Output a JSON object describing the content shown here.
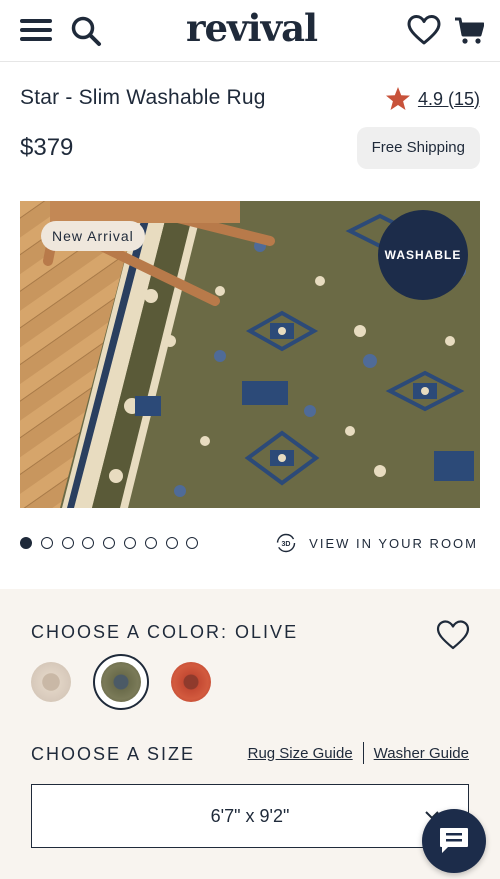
{
  "header": {
    "logo": "revival",
    "icons": [
      "menu-icon",
      "search-icon",
      "heart-icon",
      "cart-icon"
    ]
  },
  "product": {
    "title": "Star - Slim Washable Rug",
    "rating": "4.9",
    "review_count": "(15)",
    "price": "$379",
    "shipping_badge": "Free Shipping"
  },
  "gallery": {
    "new_badge": "New Arrival",
    "washable_badge": "WASHABLE",
    "slide_count": 9,
    "active_slide": 1,
    "view_room_label": "VIEW IN YOUR ROOM"
  },
  "options": {
    "color_heading": "CHOOSE A COLOR: OLIVE",
    "colors": [
      {
        "name": "beige",
        "hex": "#d9cbbd"
      },
      {
        "name": "olive",
        "hex": "#6b6c4b",
        "selected": true
      },
      {
        "name": "red",
        "hex": "#c44a33"
      }
    ],
    "size_heading": "CHOOSE A SIZE",
    "rug_size_guide": "Rug Size Guide",
    "washer_guide": "Washer Guide",
    "selected_size": "6'7\" x 9'2\""
  },
  "colors": {
    "navy": "#1c2c4a",
    "text": "#1f2a3a",
    "panel_bg": "#f8f4ef",
    "star": "#c8523a"
  }
}
